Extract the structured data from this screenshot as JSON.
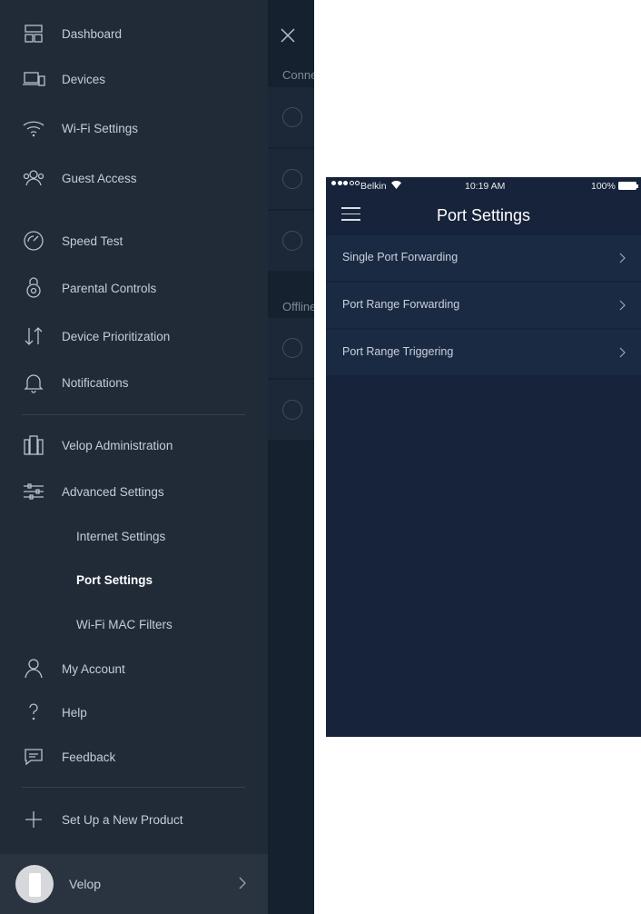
{
  "menu": {
    "items": [
      {
        "label": "Dashboard",
        "icon": "dashboard-icon"
      },
      {
        "label": "Devices",
        "icon": "devices-icon"
      },
      {
        "label": "Wi-Fi Settings",
        "icon": "wifi-icon"
      },
      {
        "label": "Guest Access",
        "icon": "guest-access-icon"
      },
      {
        "label": "Speed Test",
        "icon": "speedometer-icon"
      },
      {
        "label": "Parental Controls",
        "icon": "parental-controls-icon"
      },
      {
        "label": "Device Prioritization",
        "icon": "prioritization-arrows-icon"
      },
      {
        "label": "Notifications",
        "icon": "bell-icon"
      },
      {
        "label": "Velop Administration",
        "icon": "velop-nodes-icon"
      },
      {
        "label": "Advanced Settings",
        "icon": "sliders-icon"
      },
      {
        "label": "Internet Settings"
      },
      {
        "label": "Port Settings",
        "active": true
      },
      {
        "label": "Wi-Fi MAC Filters"
      },
      {
        "label": "My Account",
        "icon": "user-icon"
      },
      {
        "label": "Help",
        "icon": "question-icon"
      },
      {
        "label": "Feedback",
        "icon": "chat-bubble-icon"
      },
      {
        "label": "Set Up a New Product",
        "icon": "plus-icon"
      }
    ],
    "network": {
      "label": "Velop"
    }
  },
  "background_screen": {
    "sections": [
      "Conne",
      "Offline"
    ]
  },
  "phone": {
    "status_bar": {
      "carrier": "Belkin",
      "time": "10:19 AM",
      "battery": "100%"
    },
    "title": "Port Settings",
    "rows": [
      {
        "label": "Single Port Forwarding"
      },
      {
        "label": "Port Range Forwarding"
      },
      {
        "label": "Port Range Triggering"
      }
    ]
  },
  "colors": {
    "menu_background": "#212b38",
    "phone_background": "#17233a",
    "row_background": "#1b2a43"
  }
}
